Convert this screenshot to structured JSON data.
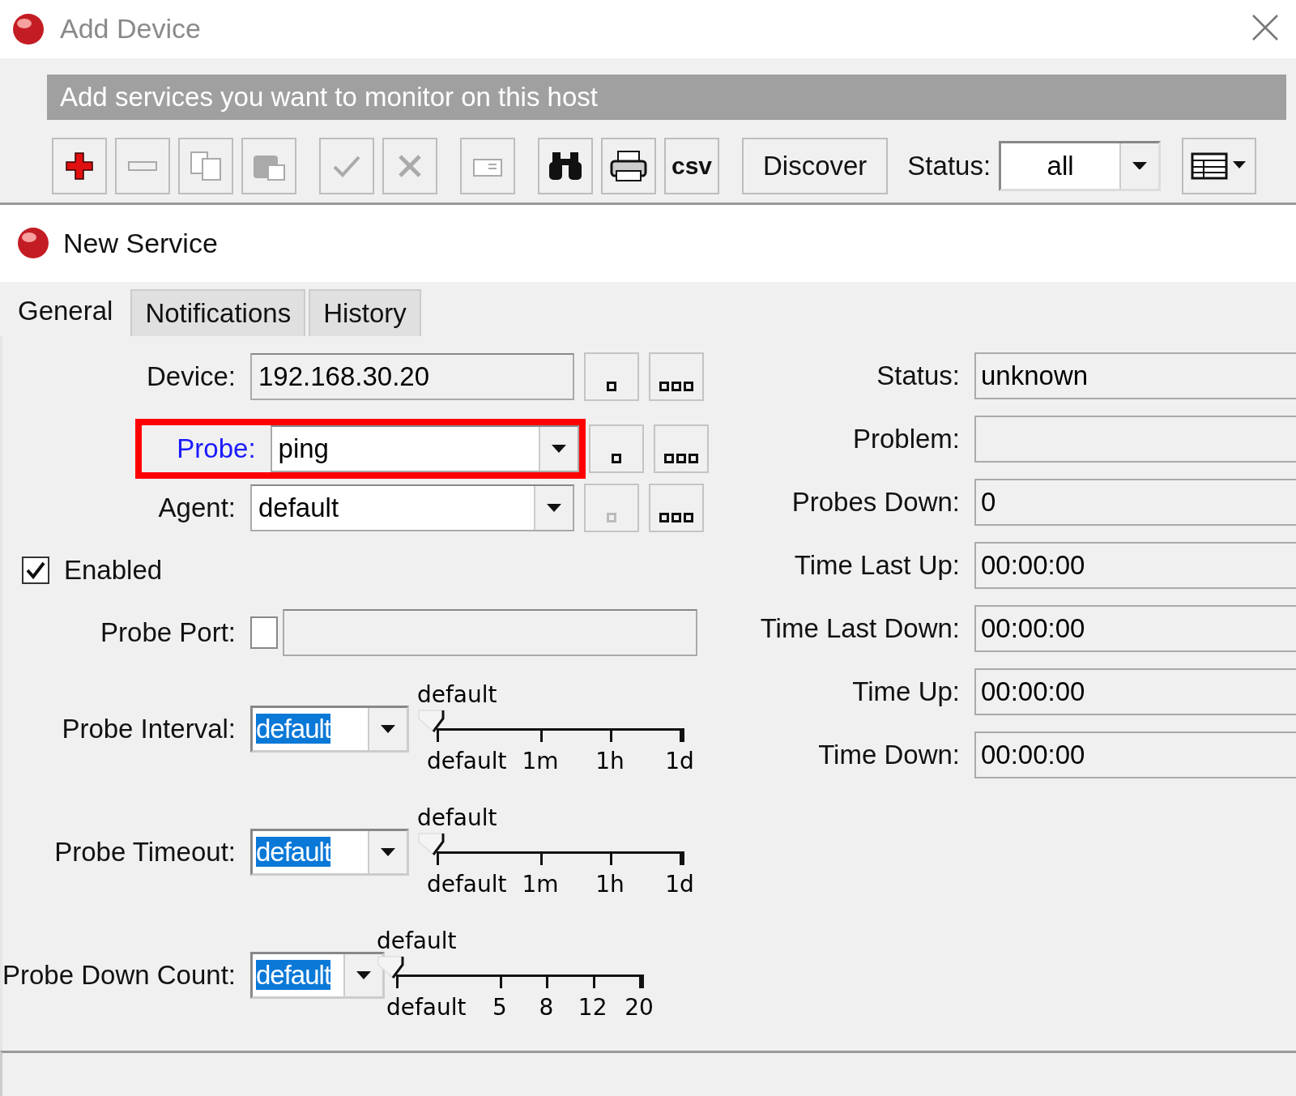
{
  "window": {
    "title": "Add Device"
  },
  "banner": "Add services you want to monitor on this host",
  "toolbar": {
    "buttons": [
      {
        "kind": "add",
        "disabled": false
      },
      {
        "kind": "remove",
        "disabled": true
      },
      {
        "kind": "copy",
        "disabled": true
      },
      {
        "kind": "paste",
        "disabled": true
      },
      {
        "kind": "enable",
        "disabled": true
      },
      {
        "kind": "disable",
        "disabled": true
      },
      {
        "kind": "comment",
        "disabled": true
      },
      {
        "kind": "find",
        "disabled": false
      },
      {
        "kind": "print",
        "disabled": false
      },
      {
        "kind": "text",
        "label": "csv",
        "disabled": false
      },
      {
        "kind": "wide",
        "label": "Discover",
        "disabled": false
      }
    ],
    "status_label": "Status:",
    "status_value": "all"
  },
  "panel": {
    "title": "New Service"
  },
  "tabs": [
    {
      "label": "General",
      "selected": true
    },
    {
      "label": "Notifications",
      "selected": false
    },
    {
      "label": "History",
      "selected": false
    }
  ],
  "form": {
    "rows": [
      {
        "kind": "field",
        "label": "Device:",
        "value": "192.168.30.20",
        "link": false,
        "highlighted": false,
        "dropdown": false,
        "side_buttons": [
          {
            "kind": "single",
            "disabled": false
          },
          {
            "kind": "triple",
            "disabled": false
          }
        ]
      },
      {
        "kind": "field",
        "label": "Probe:",
        "value": "ping",
        "link": true,
        "highlighted": true,
        "dropdown": true,
        "side_buttons": [
          {
            "kind": "single",
            "disabled": false
          },
          {
            "kind": "triple",
            "disabled": false
          }
        ]
      },
      {
        "kind": "field",
        "label": "Agent:",
        "value": "default",
        "link": false,
        "highlighted": false,
        "dropdown": true,
        "side_buttons": [
          {
            "kind": "single",
            "disabled": true
          },
          {
            "kind": "triple",
            "disabled": false
          }
        ]
      },
      {
        "kind": "checkbox",
        "label": "Enabled",
        "checked": true
      },
      {
        "kind": "port",
        "label": "Probe Port:",
        "checked": false
      },
      {
        "kind": "slider",
        "label": "Probe Interval:",
        "value": "default",
        "reading": "default",
        "level": 0,
        "ticks": [
          "default",
          "1m",
          "1h",
          "1d"
        ]
      },
      {
        "kind": "slider",
        "label": "Probe Timeout:",
        "value": "default",
        "reading": "default",
        "level": 0,
        "ticks": [
          "default",
          "1m",
          "1h",
          "1d"
        ]
      },
      {
        "kind": "slider",
        "label": "Probe Down Count:",
        "value": "default",
        "reading": "default",
        "level": 0,
        "ticks": [
          "default",
          "5",
          "8",
          "12",
          "20"
        ]
      }
    ]
  },
  "details": [
    {
      "label": "Status:",
      "value": "unknown"
    },
    {
      "label": "Problem:"
    },
    {
      "label": "Probes Down:",
      "value": "0"
    },
    {
      "label": "Time Last Up:",
      "value": "00:00:00"
    },
    {
      "label": "Time Last Down:",
      "value": "00:00:00"
    },
    {
      "label": "Time Up:",
      "value": "00:00:00"
    },
    {
      "label": "Time Down:",
      "value": "00:00:00"
    }
  ]
}
